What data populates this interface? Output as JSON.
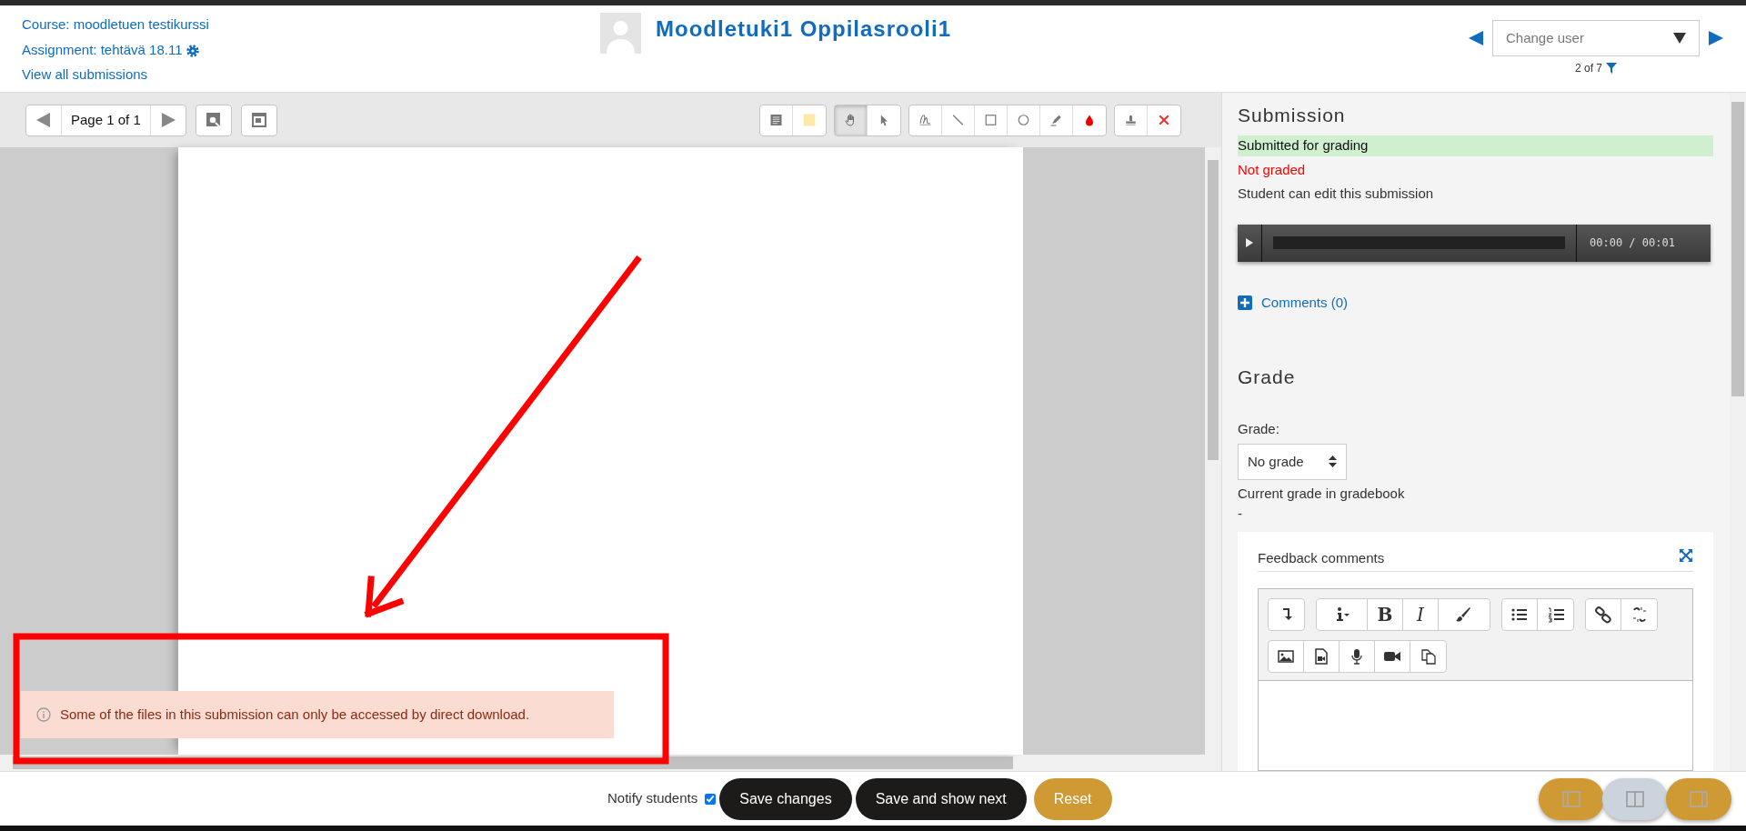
{
  "header": {
    "course_link": "Course: moodletuen testikurssi",
    "assignment_link": "Assignment: tehtävä 18.11",
    "view_all_link": "View all submissions",
    "user_name": "Moodletuki1 Oppilasrooli1",
    "change_user": {
      "placeholder": "Change user"
    },
    "counter": "2 of 7"
  },
  "viewer_toolbar": {
    "page_label": "Page 1 of 1",
    "tools": [
      {
        "kind": "comment",
        "selected": false
      },
      {
        "kind": "comment-color",
        "selected": false
      },
      {
        "kind": "hand",
        "selected": true
      },
      {
        "kind": "select",
        "selected": false
      },
      {
        "kind": "pen",
        "selected": false
      },
      {
        "kind": "line",
        "selected": false
      },
      {
        "kind": "rectangle",
        "selected": false
      },
      {
        "kind": "oval",
        "selected": false
      },
      {
        "kind": "highlight",
        "selected": false
      },
      {
        "kind": "color",
        "selected": false
      },
      {
        "kind": "stamp",
        "selected": false
      },
      {
        "kind": "delete",
        "selected": false
      }
    ]
  },
  "alert": "Some of the files in this submission can only be accessed by direct download.",
  "annotations": {
    "arrow": true,
    "frame": true
  },
  "submission": {
    "heading": "Submission",
    "status": "Submitted for grading",
    "grading_status": "Not graded",
    "edit_note": "Student can edit this submission",
    "player_time": "00:00 / 00:01",
    "comments_link": "Comments (0)"
  },
  "grade": {
    "heading": "Grade",
    "label": "Grade:",
    "select_value": "No grade",
    "gradebook_label": "Current grade in gradebook",
    "gradebook_value": "-",
    "feedback_label": "Feedback comments",
    "editor_toolbar": [
      [
        [
          {
            "kind": "collapse"
          }
        ],
        [
          {
            "kind": "info"
          },
          {
            "kind": "bold",
            "label": "B"
          },
          {
            "kind": "italic",
            "label": "I"
          },
          {
            "kind": "brush"
          }
        ],
        [
          {
            "kind": "bullets"
          },
          {
            "kind": "numbers"
          }
        ],
        [
          {
            "kind": "link"
          },
          {
            "kind": "unlink"
          }
        ]
      ],
      [
        [
          {
            "kind": "image"
          },
          {
            "kind": "media"
          },
          {
            "kind": "mic"
          },
          {
            "kind": "video"
          },
          {
            "kind": "paste"
          }
        ]
      ]
    ]
  },
  "footer": {
    "notify_label": "Notify students",
    "notify_checked": true,
    "buttons": [
      {
        "label": "Save changes",
        "kind": "dark"
      },
      {
        "label": "Save and show next",
        "kind": "dark"
      },
      {
        "label": "Reset",
        "kind": "gold"
      }
    ],
    "layout_buttons": [
      {
        "kind": "left",
        "selected": false
      },
      {
        "kind": "both",
        "selected": true
      },
      {
        "kind": "right",
        "selected": false
      }
    ]
  }
}
